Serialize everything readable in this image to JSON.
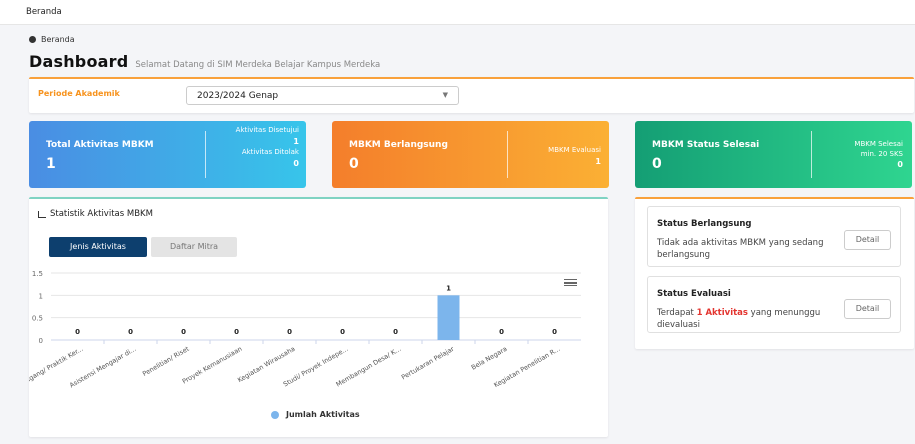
{
  "topbar": {
    "title": "Beranda"
  },
  "breadcrumb": {
    "label": "Beranda"
  },
  "page": {
    "title": "Dashboard",
    "subtitle": "Selamat Datang di SIM Merdeka Belajar Kampus Merdeka"
  },
  "periode": {
    "label": "Periode Akademik",
    "value": "2023/2024 Genap"
  },
  "cards": {
    "total": {
      "title": "Total Aktivitas MBKM",
      "value": "1",
      "disetujui_label": "Aktivitas Disetujui",
      "disetujui_value": "1",
      "ditolak_label": "Aktivitas Ditolak",
      "ditolak_value": "0"
    },
    "berlangsung": {
      "title": "MBKM Berlangsung",
      "value": "0",
      "evaluasi_label": "MBKM Evaluasi",
      "evaluasi_value": "1"
    },
    "selesai": {
      "title": "MBKM Status Selesai",
      "value": "0",
      "sks_label_1": "MBKM Selesai",
      "sks_label_2": "min. 20 SKS",
      "sks_value": "0"
    }
  },
  "stat": {
    "title": "Statistik Aktivitas MBKM",
    "tab_active": "Jenis Aktivitas",
    "tab_inactive": "Daftar Mitra"
  },
  "chart_data": {
    "type": "bar",
    "categories": [
      "Magang/ Praktik Ker...",
      "Asistensi Mengajar di...",
      "Penelitian/ Riset",
      "Proyek Kemanusiaan",
      "Kegiatan Wirausaha",
      "Studi/ Proyek Indepe...",
      "Membangun Desa/ K...",
      "Pertukaran Pelajar",
      "Bela Negara",
      "Kegiatan Penelitian R..."
    ],
    "series": [
      {
        "name": "Jumlah Aktivitas",
        "values": [
          0,
          0,
          0,
          0,
          0,
          0,
          0,
          1,
          0,
          0
        ]
      }
    ],
    "yticks": [
      "1.5",
      "1",
      "0.5",
      "0"
    ],
    "ylim": [
      0,
      1.5
    ],
    "color": "#7cb5ec",
    "legend": "bottom"
  },
  "status": {
    "berlangsung": {
      "title": "Status Berlangsung",
      "text": "Tidak ada aktivitas MBKM yang sedang berlangsung",
      "button": "Detail"
    },
    "evaluasi": {
      "title": "Status Evaluasi",
      "text_pre": "Terdapat ",
      "text_count": "1 Aktivitas",
      "text_post": " yang menunggu dievaluasi",
      "button": "Detail"
    }
  }
}
